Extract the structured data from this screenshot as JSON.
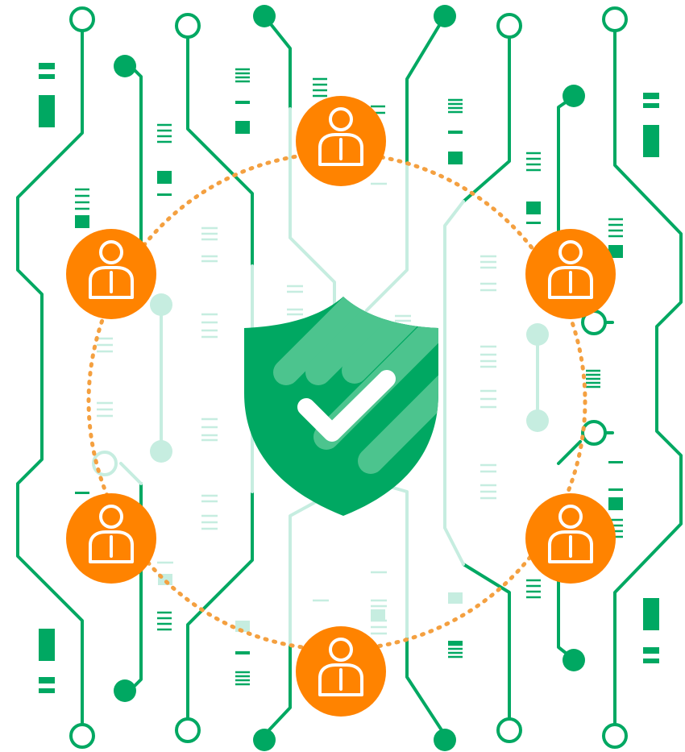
{
  "illustration": {
    "subject": "security-network",
    "colors": {
      "circuit": "#00a862",
      "circuit_faded": "#c6ede0",
      "user_fill": "#ff8300",
      "user_line": "#ffffff",
      "ring": "#f4a040",
      "shield": "#00a862",
      "shield_stripe": "#4cc48e",
      "check": "#ffffff"
    },
    "icons": {
      "center": "shield-check-icon",
      "nodes": [
        "user-icon",
        "user-icon",
        "user-icon",
        "user-icon",
        "user-icon",
        "user-icon"
      ]
    }
  }
}
